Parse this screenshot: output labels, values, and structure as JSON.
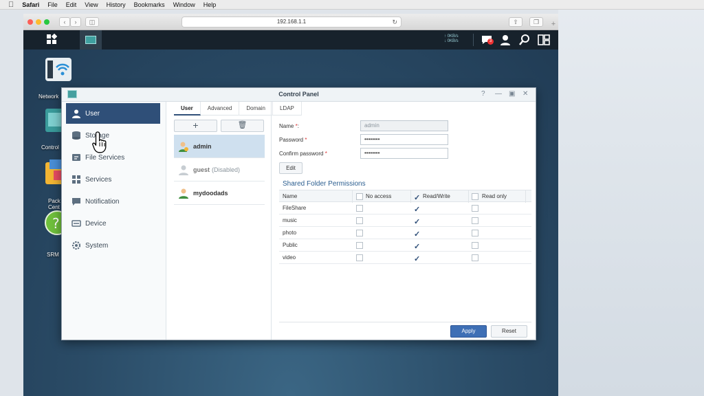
{
  "menubar": {
    "app": "Safari",
    "items": [
      "File",
      "Edit",
      "View",
      "History",
      "Bookmarks",
      "Window",
      "Help"
    ]
  },
  "browser": {
    "url": "192.168.1.1"
  },
  "taskbar": {
    "upload_speed": "0KB/s",
    "download_speed": "0KB/s",
    "notification_count": "3"
  },
  "desktop": {
    "icons": [
      "Network",
      "Control",
      "Pack Cent",
      "SRM"
    ]
  },
  "control_panel": {
    "title": "Control Panel",
    "sidebar": [
      {
        "label": "User",
        "icon": "user-icon"
      },
      {
        "label": "Storage",
        "icon": "storage-icon"
      },
      {
        "label": "File Services",
        "icon": "file-services-icon"
      },
      {
        "label": "Services",
        "icon": "services-icon"
      },
      {
        "label": "Notification",
        "icon": "notification-icon"
      },
      {
        "label": "Device",
        "icon": "device-icon"
      },
      {
        "label": "System",
        "icon": "system-icon"
      }
    ],
    "tabs": [
      "User",
      "Advanced",
      "Domain",
      "LDAP"
    ],
    "users": [
      {
        "name": "admin"
      },
      {
        "name": "guest",
        "status": "(Disabled)"
      },
      {
        "name": "mydoodads"
      }
    ],
    "form": {
      "name_label": "Name",
      "name_value": "admin",
      "password_label": "Password",
      "password_value": "••••••••",
      "confirm_label": "Confirm password",
      "confirm_value": "••••••••",
      "edit_label": "Edit"
    },
    "permissions": {
      "title": "Shared Folder Permissions",
      "headers": [
        "Name",
        "No access",
        "Read/Write",
        "Read only"
      ],
      "rows": [
        {
          "name": "FileShare",
          "value": "Read/Write"
        },
        {
          "name": "music",
          "value": "Read/Write"
        },
        {
          "name": "photo",
          "value": "Read/Write"
        },
        {
          "name": "Public",
          "value": "Read/Write"
        },
        {
          "name": "video",
          "value": "Read/Write"
        }
      ]
    },
    "apply_label": "Apply",
    "reset_label": "Reset"
  }
}
